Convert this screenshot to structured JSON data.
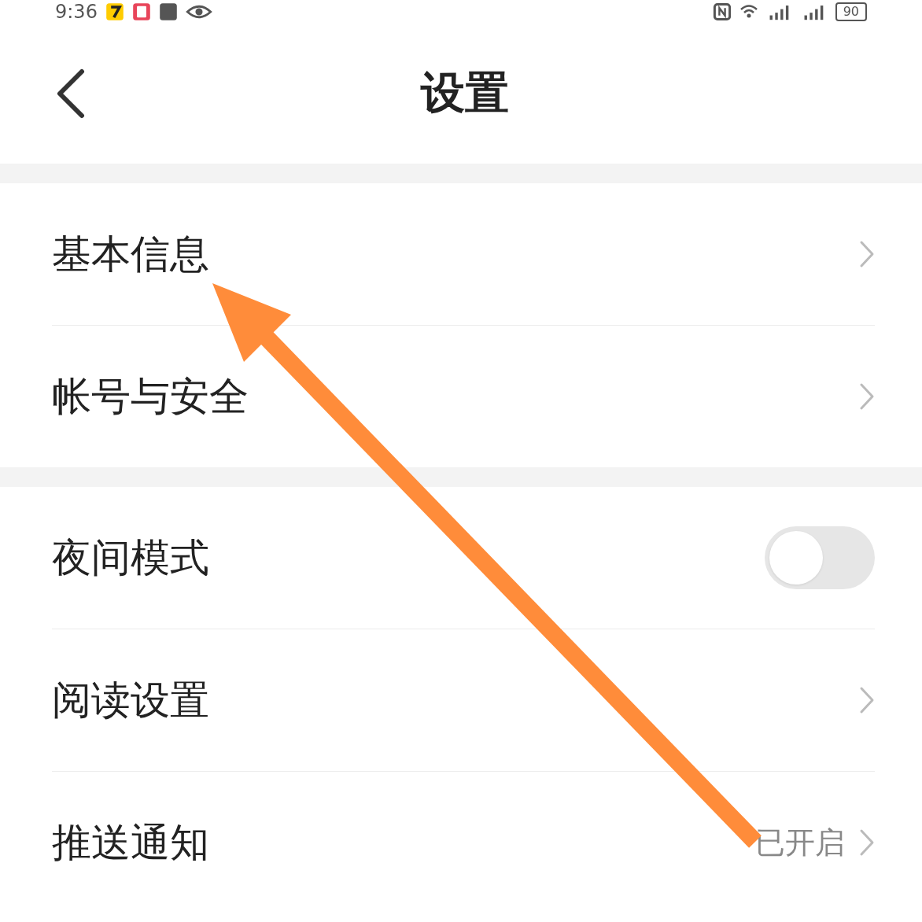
{
  "status_bar": {
    "time": "9:36",
    "battery": "90"
  },
  "header": {
    "title": "设置"
  },
  "sections": [
    {
      "rows": [
        {
          "kind": "link",
          "label": "基本信息"
        },
        {
          "kind": "link",
          "label": "帐号与安全"
        }
      ]
    },
    {
      "rows": [
        {
          "kind": "toggle",
          "label": "夜间模式",
          "on": false
        },
        {
          "kind": "link",
          "label": "阅读设置"
        },
        {
          "kind": "link",
          "label": "推送通知",
          "value": "已开启"
        }
      ]
    }
  ],
  "annotations": [
    {
      "kind": "arrow",
      "color": "#ff8c3a"
    }
  ]
}
